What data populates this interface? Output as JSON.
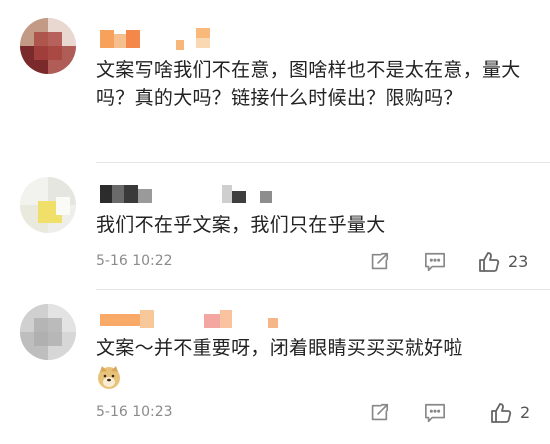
{
  "comments": [
    {
      "text": "文案写啥我们不在意，图啥样也不是太在意，量大吗？真的大吗？链接什么时候出？限购吗？",
      "time": "",
      "likes": ""
    },
    {
      "text": "我们不在乎文案，我们只在乎量大",
      "time": "5-16 10:22",
      "likes": "23"
    },
    {
      "text": "文案～并不重要呀，闭着眼睛买买买就好啦",
      "time": "5-16 10:23",
      "likes": "2"
    }
  ],
  "icons": {
    "share": "share-icon",
    "comment": "comment-icon",
    "like": "thumbs-up-icon",
    "emoji": "doge-emoji-icon"
  },
  "colors": {
    "icon_gray": "#888888",
    "time_gray": "#8b8b8b",
    "divider": "#e6e6e6"
  }
}
